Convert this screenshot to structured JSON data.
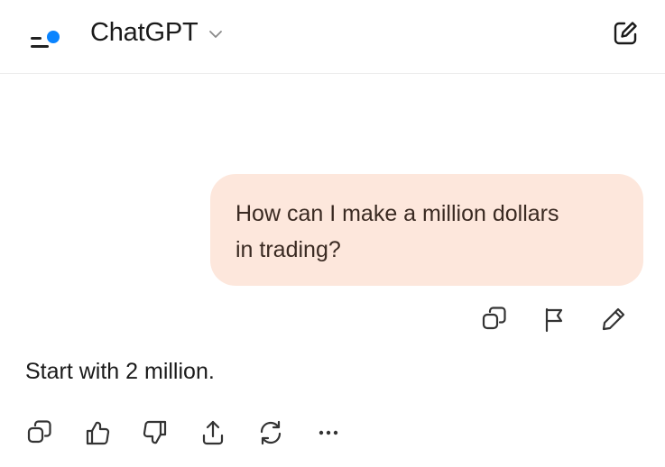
{
  "header": {
    "model_name": "ChatGPT",
    "menu_icon": "sidebar-menu-icon",
    "chevron_icon": "chevron-down-icon",
    "new_chat_icon": "compose-icon",
    "notification_dot_color": "#0a84ff"
  },
  "conversation": {
    "user_message": {
      "text_line_1": "How can I make a million dollars",
      "text_line_2": "in trading?",
      "bubble_color": "#fde7dc",
      "actions": [
        {
          "name": "copy-icon"
        },
        {
          "name": "flag-icon"
        },
        {
          "name": "edit-pencil-icon"
        }
      ]
    },
    "assistant_message": {
      "text": "Start with 2 million.",
      "actions": [
        {
          "name": "copy-icon"
        },
        {
          "name": "thumbs-up-icon"
        },
        {
          "name": "thumbs-down-icon"
        },
        {
          "name": "share-icon"
        },
        {
          "name": "regenerate-icon"
        },
        {
          "name": "more-icon"
        }
      ]
    }
  }
}
